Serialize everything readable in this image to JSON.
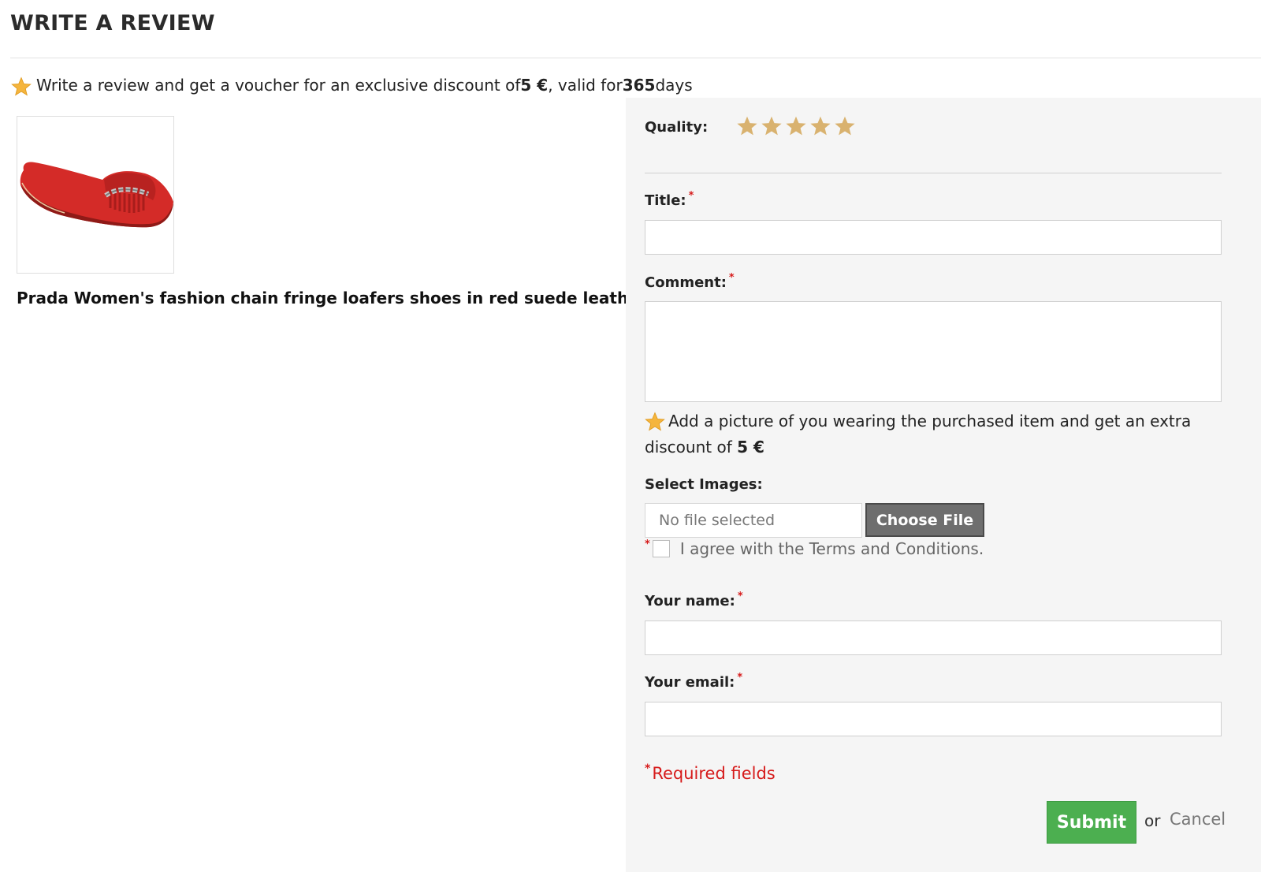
{
  "header": {
    "title": "WRITE A REVIEW"
  },
  "promo": {
    "text_before": "Write a review and get a voucher for an exclusive discount of ",
    "discount": "5 €",
    "text_middle": ", valid for ",
    "days": "365",
    "text_after": " days"
  },
  "product": {
    "name": "Prada Women's fashion chain fringe loafers shoes in red suede leather"
  },
  "form": {
    "quality_label": "Quality:",
    "rating": {
      "selected": 5,
      "max": 5,
      "color": "#d9b26f"
    },
    "title_label": "Title:",
    "title_value": "",
    "comment_label": "Comment:",
    "comment_value": "",
    "picture_note_text": "Add a picture of you wearing the purchased item and get an extra discount of ",
    "picture_note_discount": "5 €",
    "select_images_label": "Select Images:",
    "file_status": "No file selected",
    "choose_file_label": "Choose File",
    "terms_label": "I agree with the Terms and Conditions.",
    "terms_checked": false,
    "name_label": "Your name:",
    "name_value": "",
    "email_label": "Your email:",
    "email_value": "",
    "required_asterisk": "*",
    "required_note": "Required fields",
    "submit_label": "Submit",
    "or_text": "or",
    "cancel_label": "Cancel"
  },
  "colors": {
    "accent_star": "#f5b53d",
    "submit_green": "#4caf50",
    "required_red": "#d61a1a",
    "panel_bg": "#f5f5f5",
    "product_red": "#d42b28"
  },
  "icons": {
    "promo": "star-icon",
    "rating": "star-icon",
    "product": "shoe-image"
  }
}
